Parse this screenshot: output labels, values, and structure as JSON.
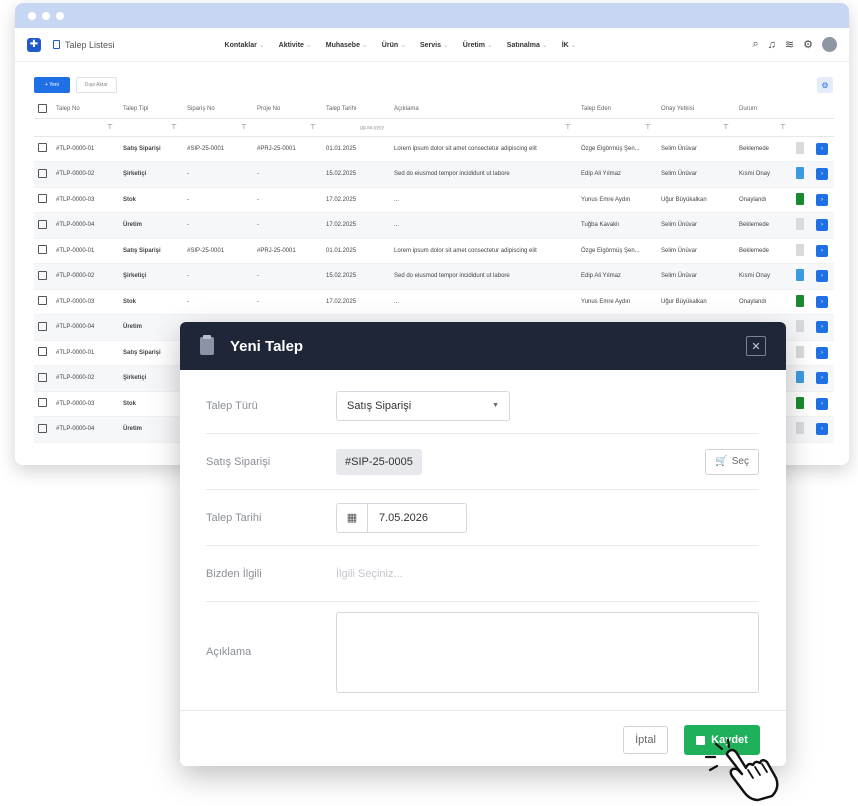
{
  "app": {
    "title": "Talep Listesi",
    "menu": [
      "Kontaklar",
      "Aktivite",
      "Muhasebe",
      "Ürün",
      "Servis",
      "Üretim",
      "Satınalma",
      "İK"
    ]
  },
  "toolbar": {
    "new_label": "+ Yeni",
    "export_label": "Dışa Aktar"
  },
  "table": {
    "headers": [
      "Talep No",
      "Talep Tipi",
      "Sipariş No",
      "Proje No",
      "Talep Tarihi",
      "Açıklama",
      "Talep Eden",
      "Onay Yetkisi",
      "Durum"
    ],
    "date_filter_placeholder": "gg.aa.yyyy",
    "rows": [
      {
        "no": "#TLP-0000-01",
        "type": "Satış Siparişi",
        "order": "#SIP-25-0001",
        "project": "#PRJ-25-0001",
        "date": "01.01.2025",
        "desc": "Lorem ipsum dolor sit amet consectetur adipiscing elit",
        "requester": "Özge Elgörmüş Şen...",
        "approver": "Selim Ünüvar",
        "status": "Beklemede",
        "color": "#d9dadd"
      },
      {
        "no": "#TLP-0000-02",
        "type": "Şirketiçi",
        "order": "-",
        "project": "-",
        "date": "15.02.2025",
        "desc": "Sed do eiusmod tempor incididunt ut labore",
        "requester": "Edip Ali Yılmaz",
        "approver": "Selim Ünüvar",
        "status": "Kısmi Onay",
        "color": "#3a9be0"
      },
      {
        "no": "#TLP-0000-03",
        "type": "Stok",
        "order": "-",
        "project": "-",
        "date": "17.02.2025",
        "desc": "...",
        "requester": "Yunus Emre Aydın",
        "approver": "Uğur Büyükalkan",
        "status": "Onaylandı",
        "color": "#1a8a2e"
      },
      {
        "no": "#TLP-0000-04",
        "type": "Üretim",
        "order": "-",
        "project": "-",
        "date": "17.02.2025",
        "desc": "...",
        "requester": "Tuğba Kavaklı",
        "approver": "Selim Ünüvar",
        "status": "Beklemede",
        "color": "#d9dadd"
      },
      {
        "no": "#TLP-0000-01",
        "type": "Satış Siparişi",
        "order": "#SIP-25-0001",
        "project": "#PRJ-25-0001",
        "date": "01.01.2025",
        "desc": "Lorem ipsum dolor sit amet consectetur adipiscing elit",
        "requester": "Özge Elgörmüş Şen...",
        "approver": "Selim Ünüvar",
        "status": "Beklemede",
        "color": "#d9dadd"
      },
      {
        "no": "#TLP-0000-02",
        "type": "Şirketiçi",
        "order": "-",
        "project": "-",
        "date": "15.02.2025",
        "desc": "Sed do eiusmod tempor incididunt ut labore",
        "requester": "Edip Ali Yılmaz",
        "approver": "Selim Ünüvar",
        "status": "Kısmi Onay",
        "color": "#3a9be0"
      },
      {
        "no": "#TLP-0000-03",
        "type": "Stok",
        "order": "-",
        "project": "-",
        "date": "17.02.2025",
        "desc": "...",
        "requester": "Yunus Emre Aydın",
        "approver": "Uğur Büyükalkan",
        "status": "Onaylandı",
        "color": "#1a8a2e"
      },
      {
        "no": "#TLP-0000-04",
        "type": "Üretim",
        "order": "",
        "project": "",
        "date": "",
        "desc": "",
        "requester": "",
        "approver": "",
        "status": "",
        "color": "#d9dadd"
      },
      {
        "no": "#TLP-0000-01",
        "type": "Satış Siparişi",
        "order": "",
        "project": "",
        "date": "",
        "desc": "",
        "requester": "",
        "approver": "",
        "status": "",
        "color": "#d9dadd"
      },
      {
        "no": "#TLP-0000-02",
        "type": "Şirketiçi",
        "order": "",
        "project": "",
        "date": "",
        "desc": "",
        "requester": "",
        "approver": "",
        "status": "",
        "color": "#3a9be0"
      },
      {
        "no": "#TLP-0000-03",
        "type": "Stok",
        "order": "",
        "project": "",
        "date": "",
        "desc": "",
        "requester": "",
        "approver": "",
        "status": "",
        "color": "#1a8a2e"
      },
      {
        "no": "#TLP-0000-04",
        "type": "Üretim",
        "order": "",
        "project": "",
        "date": "",
        "desc": "",
        "requester": "",
        "approver": "",
        "status": "",
        "color": "#d9dadd"
      }
    ]
  },
  "modal": {
    "title": "Yeni Talep",
    "type_label": "Talep Türü",
    "type_value": "Satış Siparişi",
    "order_label": "Satış Siparişi",
    "order_value": "#SIP-25-0005",
    "select_button": "Seç",
    "date_label": "Talep Tarihi",
    "date_value": "7.05.2026",
    "related_label": "Bizden İlgili",
    "related_placeholder": "İlgili Seçiniz...",
    "desc_label": "Açıklama",
    "cancel_label": "İptal",
    "save_label": "Kaydet"
  },
  "colors": {
    "accent": "#1f6fe5",
    "save": "#1eb05a",
    "modal_header": "#1f2638"
  }
}
